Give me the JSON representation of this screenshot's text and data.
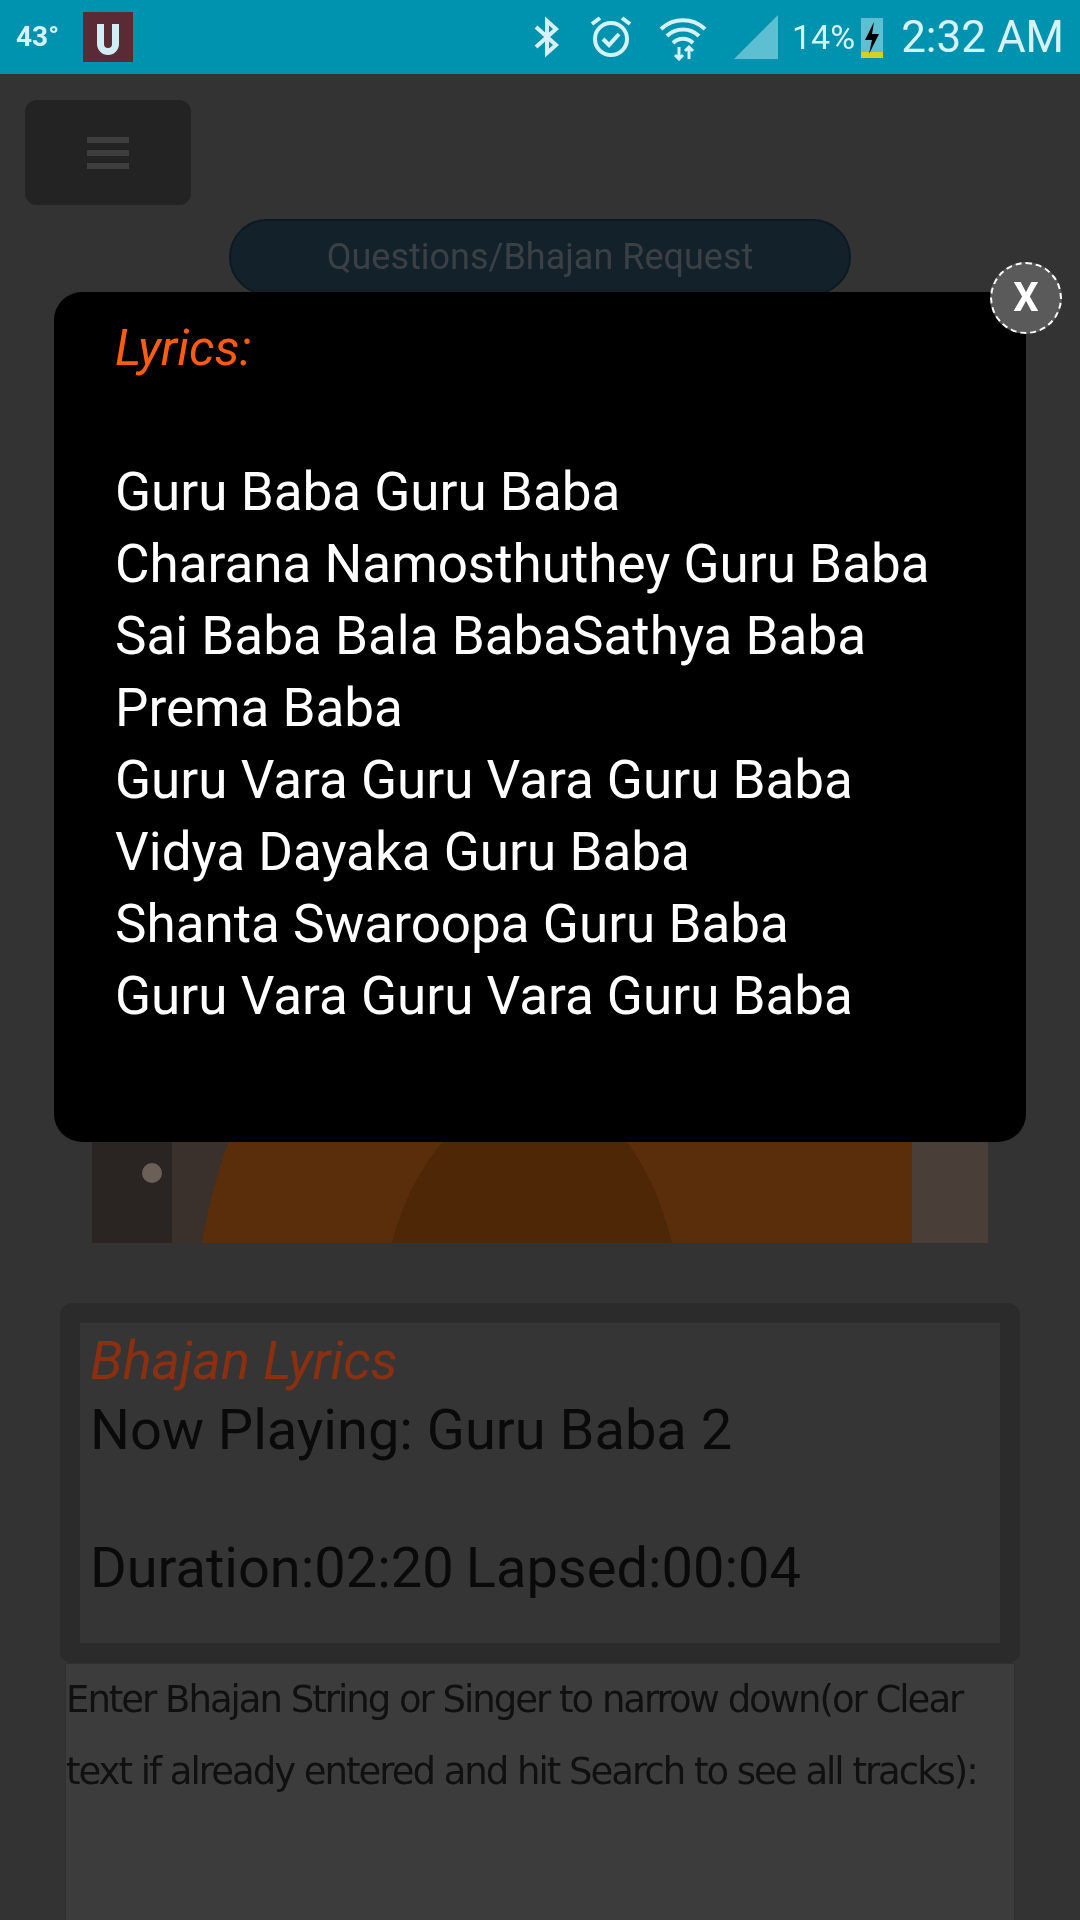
{
  "status_bar": {
    "temperature": "43°",
    "battery": "14%",
    "time": "2:32 AM"
  },
  "page": {
    "request_button": "Questions/Bhajan Request",
    "player": {
      "title": "Bhajan Lyrics",
      "now_playing": "Now Playing: Guru Baba 2",
      "duration": "Duration:02:20",
      "lapsed": "Lapsed:00:04"
    },
    "search_hint": "Enter Bhajan String or Singer to narrow down(or Clear text if already entered and hit Search to see all tracks):"
  },
  "popup": {
    "close": "X",
    "heading": "Lyrics:",
    "lines": [
      "Guru Baba Guru Baba",
      "Charana Namosthuthey Guru Baba",
      "Sai Baba Bala BabaSathya Baba",
      "Prema Baba",
      "Guru Vara Guru Vara Guru Baba",
      "Vidya Dayaka Guru Baba",
      "Shanta Swaroopa Guru Baba",
      "Guru Vara Guru Vara Guru Baba"
    ]
  }
}
